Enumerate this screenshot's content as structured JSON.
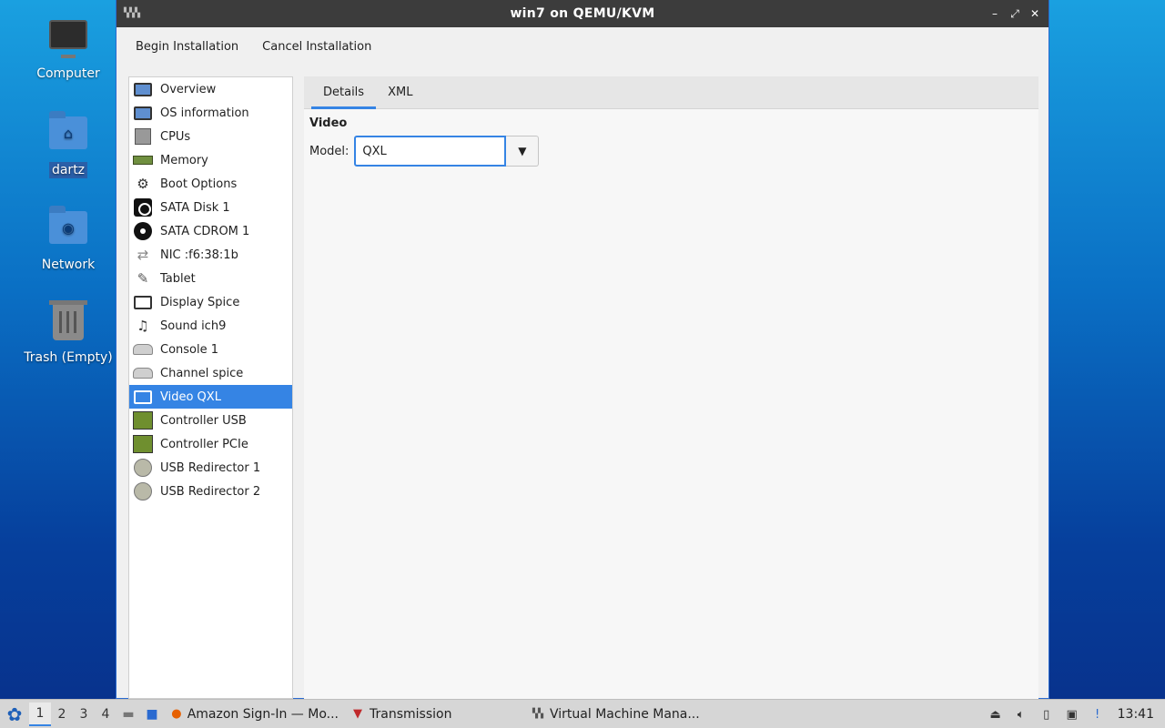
{
  "desktop": {
    "icons": [
      {
        "label": "Computer"
      },
      {
        "label": "dartz"
      },
      {
        "label": "Network"
      },
      {
        "label": "Trash (Empty)"
      }
    ]
  },
  "window": {
    "title": "win7 on QEMU/KVM",
    "controls": {
      "minimize": "–",
      "restore": "⤢",
      "close": "✕"
    }
  },
  "toolbar": {
    "begin_label": "Begin Installation",
    "cancel_label": "Cancel Installation"
  },
  "sidebar": {
    "items": [
      {
        "label": "Overview",
        "icon": "monitor-icon"
      },
      {
        "label": "OS information",
        "icon": "monitor-icon"
      },
      {
        "label": "CPUs",
        "icon": "cpu-icon"
      },
      {
        "label": "Memory",
        "icon": "memory-icon"
      },
      {
        "label": "Boot Options",
        "icon": "gears-icon"
      },
      {
        "label": "SATA Disk 1",
        "icon": "hard-disk-icon"
      },
      {
        "label": "SATA CDROM 1",
        "icon": "cdrom-icon"
      },
      {
        "label": "NIC :f6:38:1b",
        "icon": "network-arrows-icon"
      },
      {
        "label": "Tablet",
        "icon": "tablet-icon"
      },
      {
        "label": "Display Spice",
        "icon": "display-icon"
      },
      {
        "label": "Sound ich9",
        "icon": "sound-icon"
      },
      {
        "label": "Console 1",
        "icon": "serial-icon"
      },
      {
        "label": "Channel spice",
        "icon": "serial-icon"
      },
      {
        "label": "Video QXL",
        "icon": "video-icon",
        "selected": true
      },
      {
        "label": "Controller USB",
        "icon": "controller-icon"
      },
      {
        "label": "Controller PCIe",
        "icon": "controller-icon"
      },
      {
        "label": "USB Redirector 1",
        "icon": "usb-icon"
      },
      {
        "label": "USB Redirector 2",
        "icon": "usb-icon"
      }
    ]
  },
  "tabs": [
    {
      "label": "Details",
      "active": true
    },
    {
      "label": "XML",
      "active": false
    }
  ],
  "details": {
    "section_title": "Video",
    "model_label": "Model:",
    "model_value": "QXL"
  },
  "taskbar": {
    "workspaces": [
      "1",
      "2",
      "3",
      "4"
    ],
    "tasks": [
      {
        "label": "Amazon Sign-In — Mo..."
      },
      {
        "label": "Transmission"
      },
      {
        "label": "Virtual Machine Mana..."
      }
    ],
    "clock": "13:41"
  },
  "colors": {
    "accent": "#3584e4",
    "titlebar": "#3c3c3c",
    "taskbar": "#d6d6d6"
  }
}
